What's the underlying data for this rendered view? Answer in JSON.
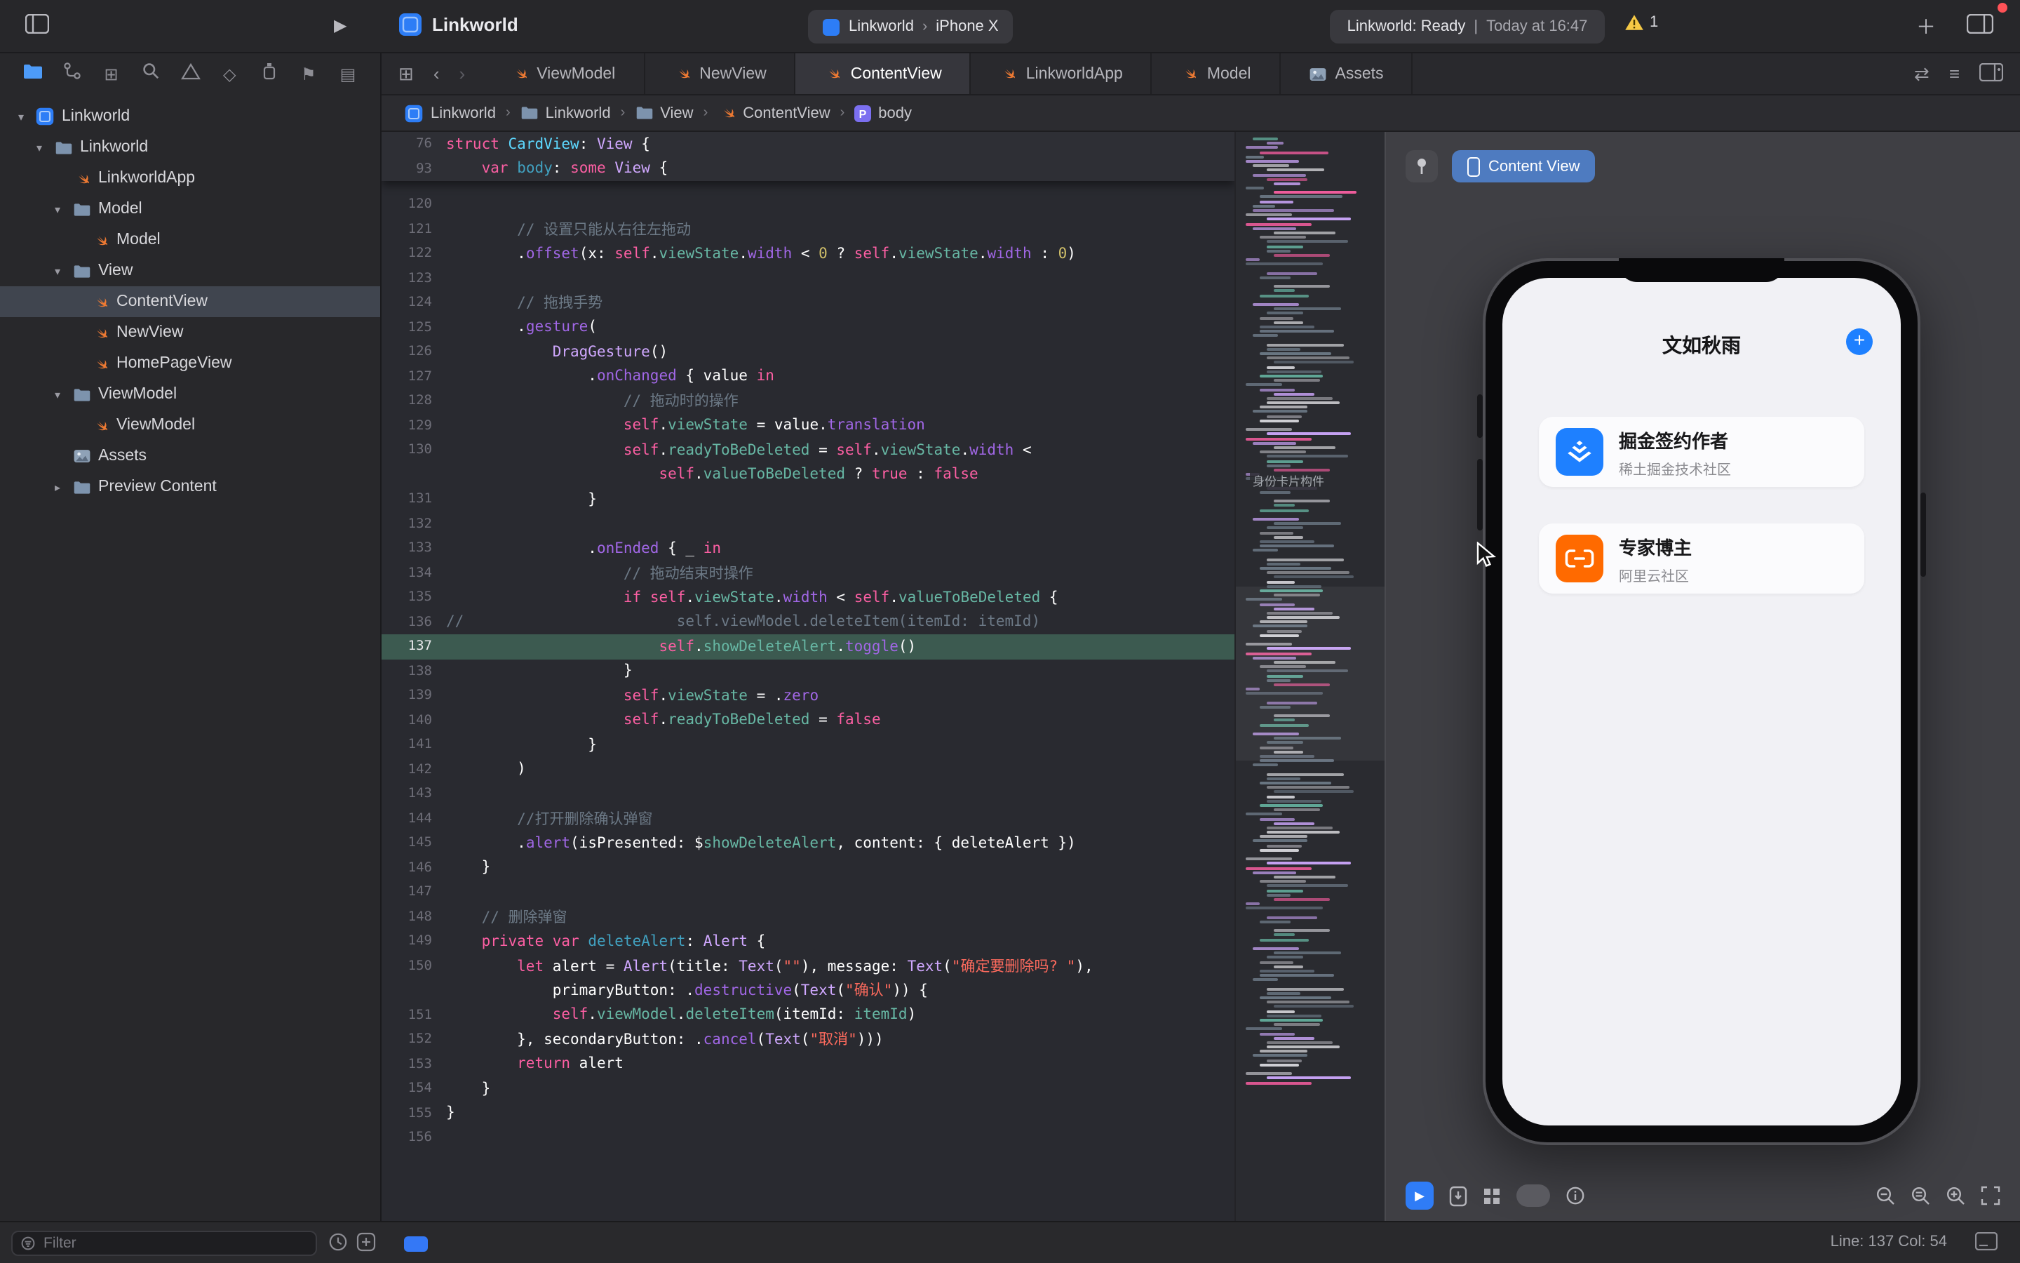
{
  "titlebar": {
    "project_title": "Linkworld",
    "scheme": {
      "name": "Linkworld",
      "destination": "iPhone X"
    },
    "status": {
      "left": "Linkworld: Ready",
      "right": "Today at 16:47",
      "issue_count": "1"
    }
  },
  "tabbar": {
    "tabs": [
      {
        "label": "ViewModel",
        "icon": "swift-file-icon",
        "active": false
      },
      {
        "label": "NewView",
        "icon": "swift-file-icon",
        "active": false
      },
      {
        "label": "ContentView",
        "icon": "swift-file-icon",
        "active": true
      },
      {
        "label": "LinkworldApp",
        "icon": "swift-file-icon",
        "active": false
      },
      {
        "label": "Model",
        "icon": "swift-file-icon",
        "active": false
      },
      {
        "label": "Assets",
        "icon": "assets-icon",
        "active": false
      }
    ]
  },
  "breadcrumb": {
    "items": [
      {
        "label": "Linkworld",
        "icon": "project-icon"
      },
      {
        "label": "Linkworld",
        "icon": "folder-icon"
      },
      {
        "label": "View",
        "icon": "folder-icon"
      },
      {
        "label": "ContentView",
        "icon": "swift-file-icon"
      },
      {
        "label": "body",
        "icon": "property-icon"
      }
    ]
  },
  "navigator": {
    "filter_placeholder": "Filter",
    "tree": [
      {
        "label": "Linkworld",
        "depth": 0,
        "icon": "project-icon",
        "disclosure": "open",
        "selected": false
      },
      {
        "label": "Linkworld",
        "depth": 1,
        "icon": "folder-icon",
        "disclosure": "open",
        "selected": false
      },
      {
        "label": "LinkworldApp",
        "depth": 2,
        "icon": "swift-file-icon",
        "disclosure": null,
        "selected": false
      },
      {
        "label": "Model",
        "depth": 2,
        "icon": "folder-icon",
        "disclosure": "open",
        "selected": false
      },
      {
        "label": "Model",
        "depth": 3,
        "icon": "swift-file-icon",
        "disclosure": null,
        "selected": false
      },
      {
        "label": "View",
        "depth": 2,
        "icon": "folder-icon",
        "disclosure": "open",
        "selected": false
      },
      {
        "label": "ContentView",
        "depth": 3,
        "icon": "swift-file-icon",
        "disclosure": null,
        "selected": true
      },
      {
        "label": "NewView",
        "depth": 3,
        "icon": "swift-file-icon",
        "disclosure": null,
        "selected": false
      },
      {
        "label": "HomePageView",
        "depth": 3,
        "icon": "swift-file-icon",
        "disclosure": null,
        "selected": false
      },
      {
        "label": "ViewModel",
        "depth": 2,
        "icon": "folder-icon",
        "disclosure": "open",
        "selected": false
      },
      {
        "label": "ViewModel",
        "depth": 3,
        "icon": "swift-file-icon",
        "disclosure": null,
        "selected": false
      },
      {
        "label": "Assets",
        "depth": 2,
        "icon": "assets-icon",
        "disclosure": null,
        "selected": false
      },
      {
        "label": "Preview Content",
        "depth": 2,
        "icon": "folder-icon",
        "disclosure": "closed",
        "selected": false
      }
    ]
  },
  "editor": {
    "highlighted_line": "137",
    "minimap_label": "身份卡片构件",
    "token_colors": {
      "kw": "#FC5FA3",
      "cm": "#6C7986",
      "str": "#FC6A5D",
      "num": "#D0BF69",
      "typeD": "#5DD8FF",
      "decl": "#41A1C0",
      "proj": "#67B7A4",
      "type": "#D0A8FF",
      "mem": "#A167E6",
      "pl": "#FFFFFF"
    },
    "sticky": [
      {
        "n": "76",
        "s": [
          [
            "kw",
            "struct"
          ],
          [
            "pl",
            " "
          ],
          [
            "typeD",
            "CardView"
          ],
          [
            "pl",
            ": "
          ],
          [
            "type",
            "View"
          ],
          [
            "pl",
            " {"
          ]
        ]
      },
      {
        "n": "93",
        "s": [
          [
            "pl",
            "    "
          ],
          [
            "kw",
            "var"
          ],
          [
            "pl",
            " "
          ],
          [
            "decl",
            "body"
          ],
          [
            "pl",
            ": "
          ],
          [
            "kw",
            "some"
          ],
          [
            "pl",
            " "
          ],
          [
            "type",
            "View"
          ],
          [
            "pl",
            " {"
          ]
        ]
      }
    ],
    "lines": [
      {
        "n": "120",
        "s": []
      },
      {
        "n": "121",
        "s": [
          [
            "pl",
            "        "
          ],
          [
            "cm",
            "// 设置只能从右往左拖动"
          ]
        ]
      },
      {
        "n": "122",
        "s": [
          [
            "pl",
            "        ."
          ],
          [
            "mem",
            "offset"
          ],
          [
            "pl",
            "(x: "
          ],
          [
            "kw",
            "self"
          ],
          [
            "pl",
            "."
          ],
          [
            "proj",
            "viewState"
          ],
          [
            "pl",
            "."
          ],
          [
            "mem",
            "width"
          ],
          [
            "pl",
            " < "
          ],
          [
            "num",
            "0"
          ],
          [
            "pl",
            " ? "
          ],
          [
            "kw",
            "self"
          ],
          [
            "pl",
            "."
          ],
          [
            "proj",
            "viewState"
          ],
          [
            "pl",
            "."
          ],
          [
            "mem",
            "width"
          ],
          [
            "pl",
            " : "
          ],
          [
            "num",
            "0"
          ],
          [
            "pl",
            ")"
          ]
        ]
      },
      {
        "n": "123",
        "s": []
      },
      {
        "n": "124",
        "s": [
          [
            "pl",
            "        "
          ],
          [
            "cm",
            "// 拖拽手势"
          ]
        ]
      },
      {
        "n": "125",
        "s": [
          [
            "pl",
            "        ."
          ],
          [
            "mem",
            "gesture"
          ],
          [
            "pl",
            "("
          ]
        ]
      },
      {
        "n": "126",
        "s": [
          [
            "pl",
            "            "
          ],
          [
            "type",
            "DragGesture"
          ],
          [
            "pl",
            "()"
          ]
        ]
      },
      {
        "n": "127",
        "s": [
          [
            "pl",
            "                ."
          ],
          [
            "mem",
            "onChanged"
          ],
          [
            "pl",
            " { value "
          ],
          [
            "kw",
            "in"
          ]
        ]
      },
      {
        "n": "128",
        "s": [
          [
            "pl",
            "                    "
          ],
          [
            "cm",
            "// 拖动时的操作"
          ]
        ]
      },
      {
        "n": "129",
        "s": [
          [
            "pl",
            "                    "
          ],
          [
            "kw",
            "self"
          ],
          [
            "pl",
            "."
          ],
          [
            "proj",
            "viewState"
          ],
          [
            "pl",
            " = value."
          ],
          [
            "mem",
            "translation"
          ]
        ]
      },
      {
        "n": "130",
        "s": [
          [
            "pl",
            "                    "
          ],
          [
            "kw",
            "self"
          ],
          [
            "pl",
            "."
          ],
          [
            "proj",
            "readyToBeDeleted"
          ],
          [
            "pl",
            " = "
          ],
          [
            "kw",
            "self"
          ],
          [
            "pl",
            "."
          ],
          [
            "proj",
            "viewState"
          ],
          [
            "pl",
            "."
          ],
          [
            "mem",
            "width"
          ],
          [
            "pl",
            " <"
          ]
        ]
      },
      {
        "n": "",
        "s": [
          [
            "pl",
            "                        "
          ],
          [
            "kw",
            "self"
          ],
          [
            "pl",
            "."
          ],
          [
            "proj",
            "valueToBeDeleted"
          ],
          [
            "pl",
            " ? "
          ],
          [
            "kw",
            "true"
          ],
          [
            "pl",
            " : "
          ],
          [
            "kw",
            "false"
          ]
        ]
      },
      {
        "n": "131",
        "s": [
          [
            "pl",
            "                }"
          ]
        ]
      },
      {
        "n": "132",
        "s": []
      },
      {
        "n": "133",
        "s": [
          [
            "pl",
            "                ."
          ],
          [
            "mem",
            "onEnded"
          ],
          [
            "pl",
            " { _ "
          ],
          [
            "kw",
            "in"
          ]
        ]
      },
      {
        "n": "134",
        "s": [
          [
            "pl",
            "                    "
          ],
          [
            "cm",
            "// 拖动结束时操作"
          ]
        ]
      },
      {
        "n": "135",
        "s": [
          [
            "pl",
            "                    "
          ],
          [
            "kw",
            "if"
          ],
          [
            "pl",
            " "
          ],
          [
            "kw",
            "self"
          ],
          [
            "pl",
            "."
          ],
          [
            "proj",
            "viewState"
          ],
          [
            "pl",
            "."
          ],
          [
            "mem",
            "width"
          ],
          [
            "pl",
            " < "
          ],
          [
            "kw",
            "self"
          ],
          [
            "pl",
            "."
          ],
          [
            "proj",
            "valueToBeDeleted"
          ],
          [
            "pl",
            " {"
          ]
        ]
      },
      {
        "n": "136",
        "s": [
          [
            "cm",
            "//                        self.viewModel.deleteItem(itemId: itemId)"
          ]
        ]
      },
      {
        "n": "137",
        "s": [
          [
            "pl",
            "                        "
          ],
          [
            "kw",
            "self"
          ],
          [
            "pl",
            "."
          ],
          [
            "proj",
            "showDeleteAlert"
          ],
          [
            "pl",
            "."
          ],
          [
            "mem",
            "toggle"
          ],
          [
            "pl",
            "()"
          ]
        ]
      },
      {
        "n": "138",
        "s": [
          [
            "pl",
            "                    }"
          ]
        ]
      },
      {
        "n": "139",
        "s": [
          [
            "pl",
            "                    "
          ],
          [
            "kw",
            "self"
          ],
          [
            "pl",
            "."
          ],
          [
            "proj",
            "viewState"
          ],
          [
            "pl",
            " = ."
          ],
          [
            "mem",
            "zero"
          ]
        ]
      },
      {
        "n": "140",
        "s": [
          [
            "pl",
            "                    "
          ],
          [
            "kw",
            "self"
          ],
          [
            "pl",
            "."
          ],
          [
            "proj",
            "readyToBeDeleted"
          ],
          [
            "pl",
            " = "
          ],
          [
            "kw",
            "false"
          ]
        ]
      },
      {
        "n": "141",
        "s": [
          [
            "pl",
            "                }"
          ]
        ]
      },
      {
        "n": "142",
        "s": [
          [
            "pl",
            "        )"
          ]
        ]
      },
      {
        "n": "143",
        "s": []
      },
      {
        "n": "144",
        "s": [
          [
            "pl",
            "        "
          ],
          [
            "cm",
            "//打开删除确认弹窗"
          ]
        ]
      },
      {
        "n": "145",
        "s": [
          [
            "pl",
            "        ."
          ],
          [
            "mem",
            "alert"
          ],
          [
            "pl",
            "(isPresented: $"
          ],
          [
            "proj",
            "showDeleteAlert"
          ],
          [
            "pl",
            ", content: { deleteAlert })"
          ]
        ]
      },
      {
        "n": "146",
        "s": [
          [
            "pl",
            "    }"
          ]
        ]
      },
      {
        "n": "147",
        "s": []
      },
      {
        "n": "148",
        "s": [
          [
            "pl",
            "    "
          ],
          [
            "cm",
            "// 删除弹窗"
          ]
        ]
      },
      {
        "n": "149",
        "s": [
          [
            "pl",
            "    "
          ],
          [
            "kw",
            "private"
          ],
          [
            "pl",
            " "
          ],
          [
            "kw",
            "var"
          ],
          [
            "pl",
            " "
          ],
          [
            "decl",
            "deleteAlert"
          ],
          [
            "pl",
            ": "
          ],
          [
            "type",
            "Alert"
          ],
          [
            "pl",
            " {"
          ]
        ]
      },
      {
        "n": "150",
        "s": [
          [
            "pl",
            "        "
          ],
          [
            "kw",
            "let"
          ],
          [
            "pl",
            " alert = "
          ],
          [
            "type",
            "Alert"
          ],
          [
            "pl",
            "(title: "
          ],
          [
            "type",
            "Text"
          ],
          [
            "pl",
            "("
          ],
          [
            "str",
            "\"\""
          ],
          [
            "pl",
            "), message: "
          ],
          [
            "type",
            "Text"
          ],
          [
            "pl",
            "("
          ],
          [
            "str",
            "\"确定要删除吗? \""
          ],
          [
            "pl",
            "),"
          ]
        ]
      },
      {
        "n": "",
        "s": [
          [
            "pl",
            "            primaryButton: ."
          ],
          [
            "mem",
            "destructive"
          ],
          [
            "pl",
            "("
          ],
          [
            "type",
            "Text"
          ],
          [
            "pl",
            "("
          ],
          [
            "str",
            "\"确认\""
          ],
          [
            "pl",
            ")) {"
          ]
        ]
      },
      {
        "n": "151",
        "s": [
          [
            "pl",
            "            "
          ],
          [
            "kw",
            "self"
          ],
          [
            "pl",
            "."
          ],
          [
            "proj",
            "viewModel"
          ],
          [
            "pl",
            "."
          ],
          [
            "proj",
            "deleteItem"
          ],
          [
            "pl",
            "(itemId: "
          ],
          [
            "proj",
            "itemId"
          ],
          [
            "pl",
            ")"
          ]
        ]
      },
      {
        "n": "152",
        "s": [
          [
            "pl",
            "        }, secondaryButton: ."
          ],
          [
            "mem",
            "cancel"
          ],
          [
            "pl",
            "("
          ],
          [
            "type",
            "Text"
          ],
          [
            "pl",
            "("
          ],
          [
            "str",
            "\"取消\""
          ],
          [
            "pl",
            ")))"
          ]
        ]
      },
      {
        "n": "153",
        "s": [
          [
            "pl",
            "        "
          ],
          [
            "kw",
            "return"
          ],
          [
            "pl",
            " alert"
          ]
        ]
      },
      {
        "n": "154",
        "s": [
          [
            "pl",
            "    }"
          ]
        ]
      },
      {
        "n": "155",
        "s": [
          [
            "pl",
            "}"
          ]
        ]
      },
      {
        "n": "156",
        "s": []
      }
    ]
  },
  "canvas": {
    "preview_tab": "Content View",
    "phone": {
      "nav_title": "文如秋雨",
      "add_label": "+",
      "cards": [
        {
          "title": "掘金签约作者",
          "subtitle": "稀土掘金技术社区",
          "icon": "juejin-icon",
          "color": "#1E80FF"
        },
        {
          "title": "专家博主",
          "subtitle": "阿里云社区",
          "icon": "aliyun-icon",
          "color": "#FF6A00"
        }
      ]
    }
  },
  "statusbar": {
    "line_col": "Line: 137  Col: 54"
  }
}
